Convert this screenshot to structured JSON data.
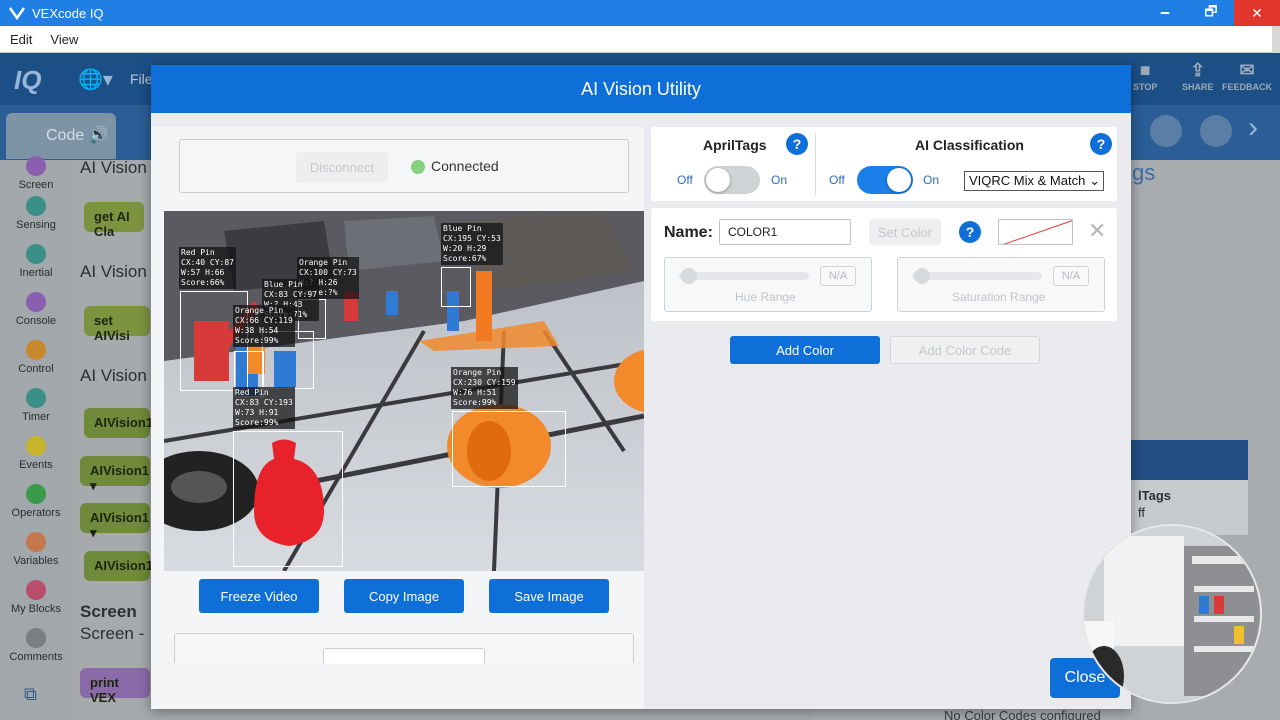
{
  "window": {
    "title": "VEXcode IQ",
    "minimize": "🗕",
    "maximize": "🗗",
    "close": "✕"
  },
  "menu": [
    "Edit",
    "View"
  ],
  "ide": {
    "logo": "IQ",
    "file": "File",
    "code_tab": "Code",
    "toolbar_right": [
      {
        "label": "STOP",
        "icon": "stop-icon"
      },
      {
        "label": "SHARE",
        "icon": "share-icon"
      },
      {
        "label": "FEEDBACK",
        "icon": "feedback-icon"
      }
    ],
    "categories": [
      {
        "label": "Screen",
        "color": "#8a5fb0"
      },
      {
        "label": "Sensing",
        "color": "#3b8f86"
      },
      {
        "label": "Inertial",
        "color": "#3b8f86"
      },
      {
        "label": "Console",
        "color": "#8a5fb0"
      },
      {
        "label": "Control",
        "color": "#c8892e"
      },
      {
        "label": "Timer",
        "color": "#3b8f86"
      },
      {
        "label": "Events",
        "color": "#c7b42a"
      },
      {
        "label": "Operators",
        "color": "#3b9a4a"
      },
      {
        "label": "Variables",
        "color": "#c2784a"
      },
      {
        "label": "My Blocks",
        "color": "#b84d6e"
      },
      {
        "label": "Comments",
        "color": "#7a7f84"
      }
    ],
    "work_labels": [
      "AI Vision",
      "AI Vision",
      "AI Vision",
      "Screen",
      "Screen -"
    ],
    "blocks": [
      "get  AI Cla",
      "set  AIVisi",
      "AIVision1",
      "AIVision1 ▾",
      "AIVision1 ▾",
      "AIVision1",
      "print  VEX"
    ],
    "right_tags": "gs",
    "right_pane_text": "lTags",
    "right_pane_text2": "ff",
    "no_codes": "No Color Codes configured"
  },
  "dialog": {
    "title": "AI Vision Utility",
    "disconnect_label": "Disconnect",
    "status_label": "Connected",
    "status_color": "#84d17e",
    "buttons": {
      "freeze": "Freeze Video",
      "copy": "Copy Image",
      "save": "Save Image",
      "add_color": "Add Color",
      "add_color_code": "Add Color Code",
      "set_color": "Set Color",
      "close": "Close"
    },
    "apriltags": {
      "title": "AprilTags",
      "off": "Off",
      "on": "On",
      "enabled": false
    },
    "ai_classification": {
      "title": "AI Classification",
      "off": "Off",
      "on": "On",
      "enabled": true,
      "model": "VIQRC Mix & Match"
    },
    "color": {
      "name_label": "Name:",
      "name_value": "COLOR1",
      "hue_label": "Hue Range",
      "sat_label": "Saturation Range",
      "na": "N/A"
    },
    "detections": [
      {
        "label": "Red Pin\nCX:40 CY:87\nW:57 H:66\nScore:66%"
      },
      {
        "label": "Orange Pin\nCX:100 CY:73\nW:? H:26\nScore:?%"
      },
      {
        "label": "Blue Pin\nCX:83 CY:97\nW:? H:43\nScore:71%"
      },
      {
        "label": "Orange Pin\nCX:66 CY:119\nW:38 H:54\nScore:99%"
      },
      {
        "label": "Blue Pin\nCX:195 CY:53\nW:20 H:29\nScore:67%"
      },
      {
        "label": "Orange Pin\nCX:230 CY:159\nW:76 H:51\nScore:99%"
      },
      {
        "label": "Red Pin\nCX:83 CY:193\nW:73 H:91\nScore:99%"
      }
    ]
  }
}
